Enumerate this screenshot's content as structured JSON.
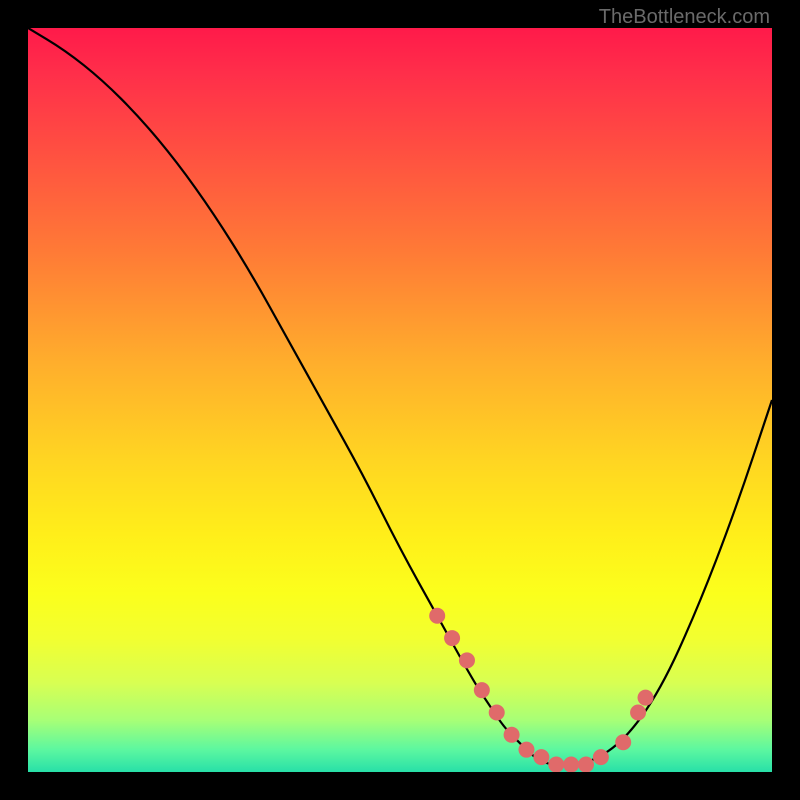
{
  "attribution": "TheBottleneck.com",
  "chart_data": {
    "type": "line",
    "title": "",
    "xlabel": "",
    "ylabel": "",
    "xlim": [
      0,
      100
    ],
    "ylim": [
      0,
      100
    ],
    "series": [
      {
        "name": "bottleneck-curve",
        "x": [
          0,
          5,
          10,
          15,
          20,
          25,
          30,
          35,
          40,
          45,
          50,
          55,
          60,
          62,
          64,
          66,
          68,
          70,
          72,
          75,
          80,
          85,
          90,
          95,
          100
        ],
        "values": [
          100,
          97,
          93,
          88,
          82,
          75,
          67,
          58,
          49,
          40,
          30,
          21,
          12,
          9,
          6,
          4,
          2,
          1,
          1,
          1,
          4,
          11,
          22,
          35,
          50
        ]
      }
    ],
    "markers": {
      "name": "sweet-spot-dots",
      "x": [
        55,
        57,
        59,
        61,
        63,
        65,
        67,
        69,
        71,
        73,
        75,
        77,
        80,
        82,
        83
      ],
      "values": [
        21,
        18,
        15,
        11,
        8,
        5,
        3,
        2,
        1,
        1,
        1,
        2,
        4,
        8,
        10
      ]
    }
  }
}
